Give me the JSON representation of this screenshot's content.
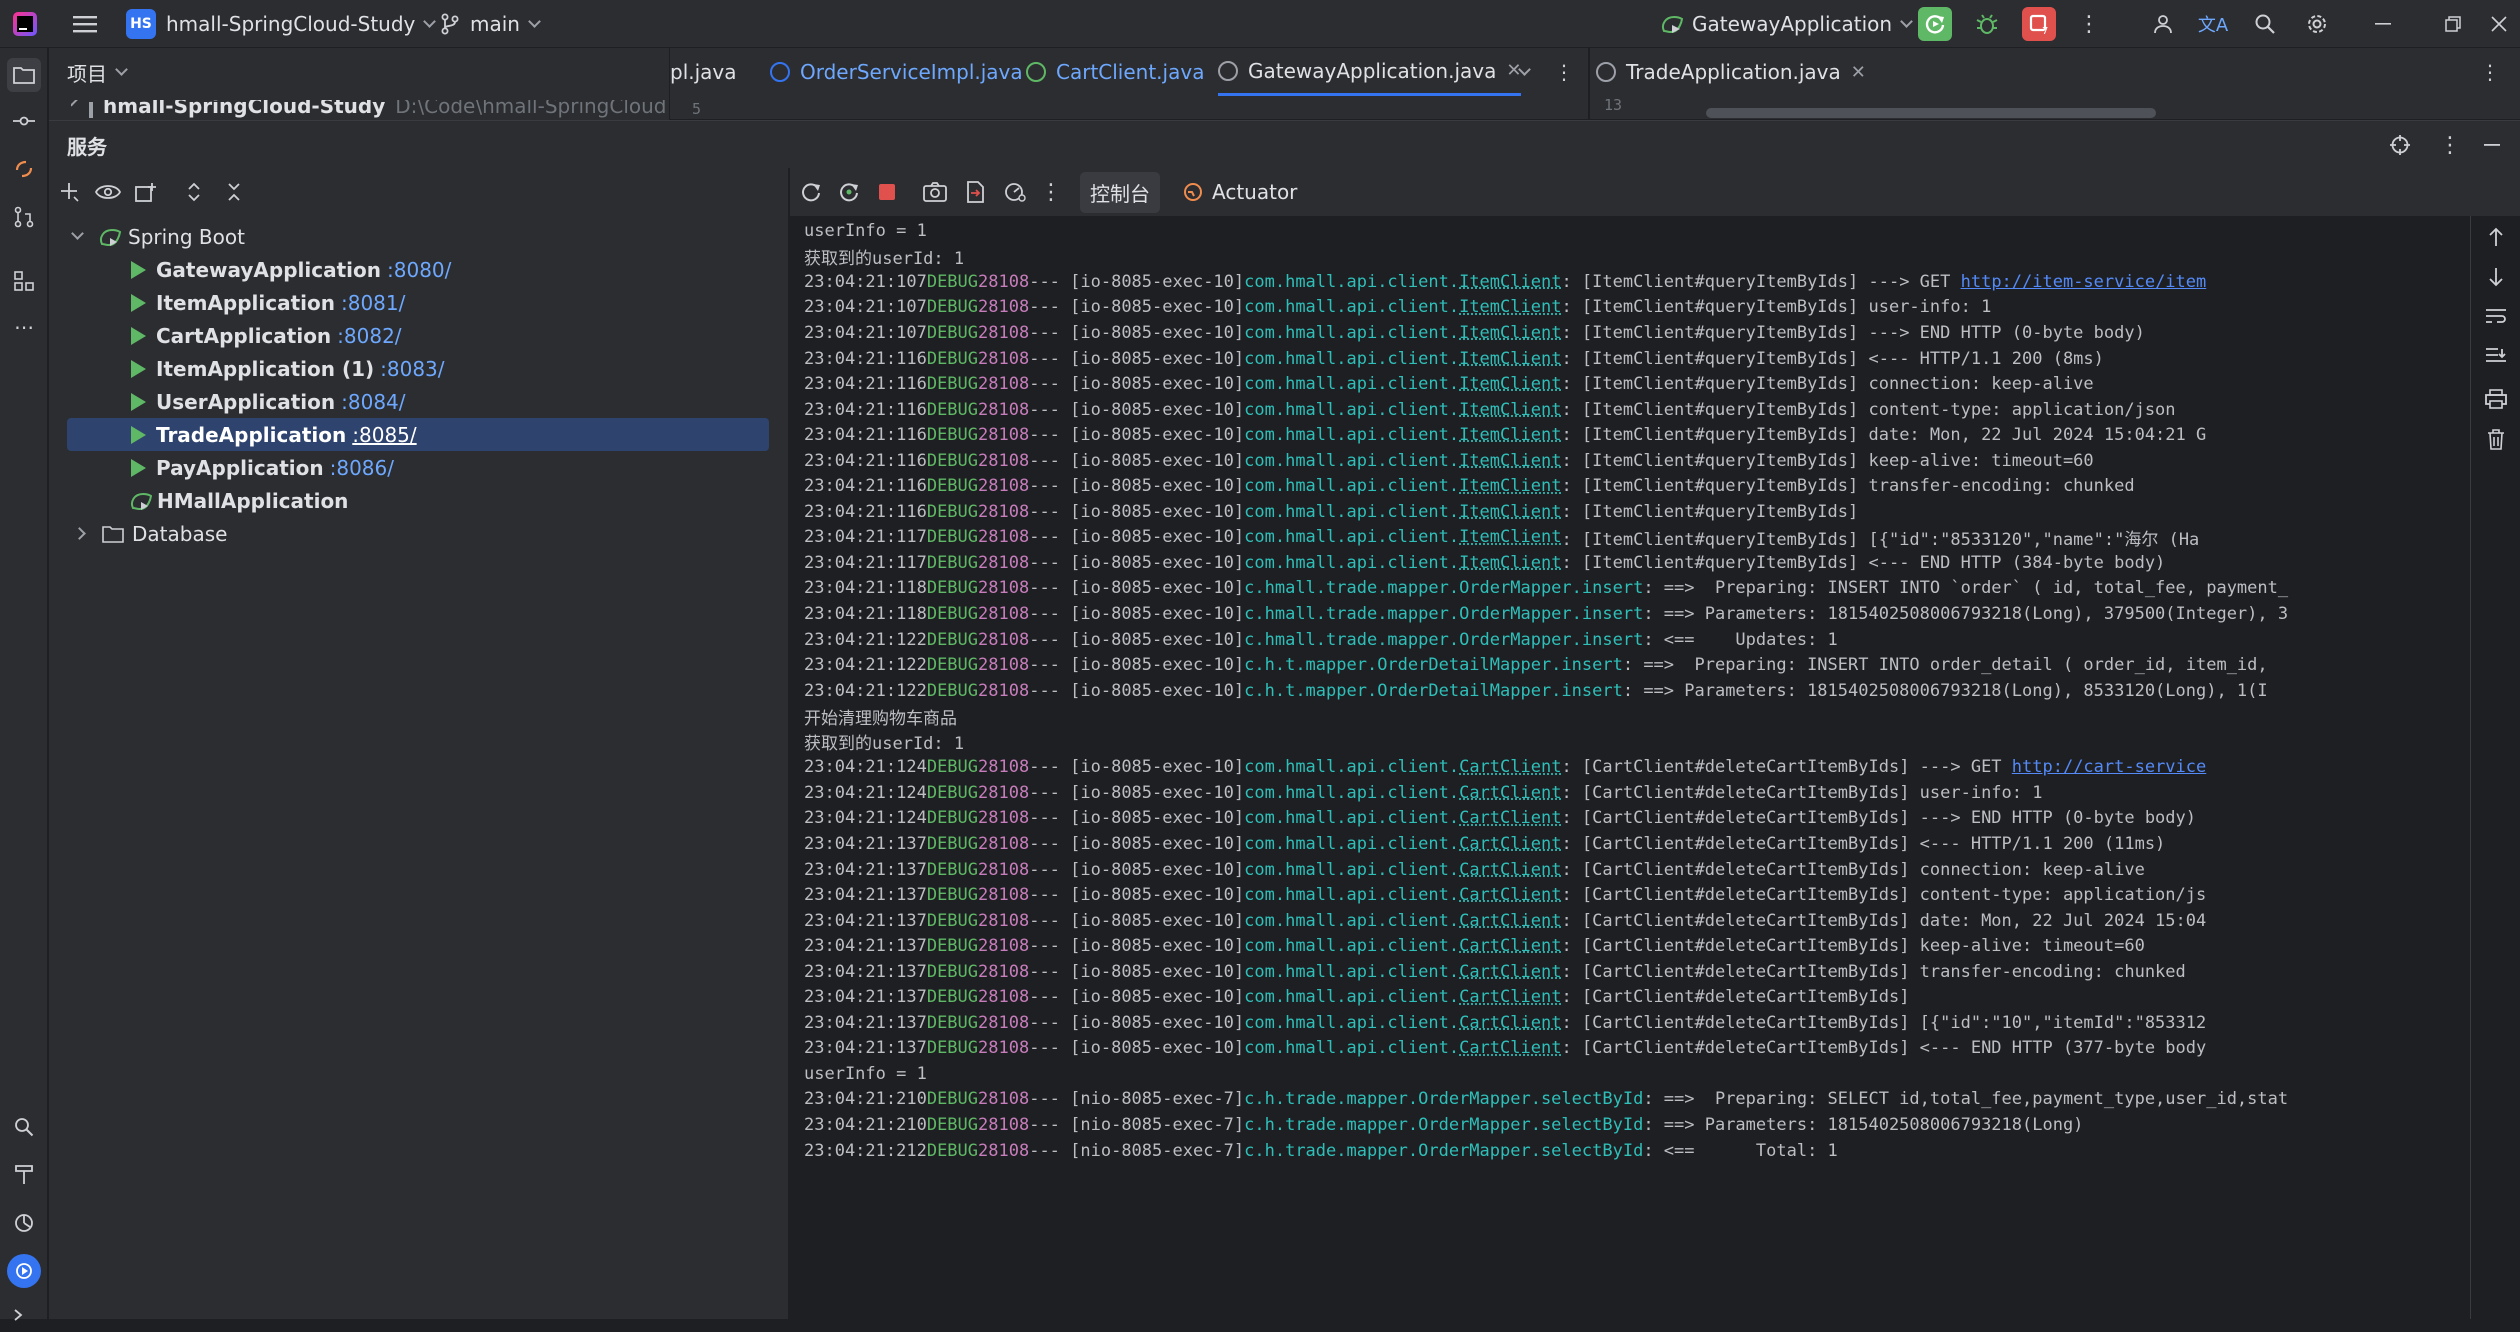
{
  "titlebar": {
    "project_badge": "HS",
    "project_name": "hmall-SpringCloud-Study",
    "branch": "main",
    "run_config": "GatewayApplication",
    "icons": [
      "app-logo-icon",
      "hamburger-menu-icon",
      "branch-icon",
      "run-config-icon",
      "rerun-icon",
      "debug-icon",
      "stop-icon",
      "more-icon",
      "user-icon",
      "translate-icon",
      "search-icon",
      "settings-icon",
      "minimize-icon",
      "restore-icon",
      "close-icon"
    ]
  },
  "project_panel": {
    "title": "项目",
    "root_label": "hmall-SpringCloud-Study",
    "root_path": "D:\\Code\\hmall-SpringCloud-St"
  },
  "editor_tabs": [
    {
      "label": "pl.java"
    },
    {
      "label": "OrderServiceImpl.java"
    },
    {
      "label": "CartClient.java"
    },
    {
      "label": "GatewayApplication.java"
    }
  ],
  "editor_tabs_right": [
    {
      "label": "TradeApplication.java"
    }
  ],
  "editor_line_left": "5",
  "editor_line_right": "13",
  "services": {
    "title": "服务",
    "console_tab": "控制台",
    "actuator_tab": "Actuator",
    "tree": {
      "group": "Spring Boot",
      "apps": [
        {
          "name": "GatewayApplication",
          "port": ":8080/"
        },
        {
          "name": "ItemApplication",
          "port": ":8081/"
        },
        {
          "name": "CartApplication",
          "port": ":8082/"
        },
        {
          "name": "ItemApplication (1)",
          "port": ":8083/"
        },
        {
          "name": "UserApplication",
          "port": ":8084/"
        },
        {
          "name": "TradeApplication",
          "port": ":8085/"
        },
        {
          "name": "PayApplication",
          "port": ":8086/"
        },
        {
          "name": "HMallApplication",
          "port": ""
        }
      ],
      "database": "Database"
    }
  },
  "console": {
    "lines": [
      {
        "plain": "userInfo = 1"
      },
      {
        "plain": "获取到的userId: 1"
      },
      {
        "t": "23:04:21:107",
        "lvl": "DEBUG",
        "pid": "28108",
        "thr": "--- [io-8085-exec-10]",
        "cls": "com.hmall.api.client.",
        "clsu": "ItemClient",
        "pad": "         ",
        "msg": ": [ItemClient#queryItemByIds] ---> GET ",
        "url": "http://item-service/item"
      },
      {
        "t": "23:04:21:107",
        "lvl": "DEBUG",
        "pid": "28108",
        "thr": "--- [io-8085-exec-10]",
        "cls": "com.hmall.api.client.",
        "clsu": "ItemClient",
        "pad": "         ",
        "msg": ": [ItemClient#queryItemByIds] user-info: 1"
      },
      {
        "t": "23:04:21:107",
        "lvl": "DEBUG",
        "pid": "28108",
        "thr": "--- [io-8085-exec-10]",
        "cls": "com.hmall.api.client.",
        "clsu": "ItemClient",
        "pad": "         ",
        "msg": ": [ItemClient#queryItemByIds] ---> END HTTP (0-byte body)"
      },
      {
        "t": "23:04:21:116",
        "lvl": "DEBUG",
        "pid": "28108",
        "thr": "--- [io-8085-exec-10]",
        "cls": "com.hmall.api.client.",
        "clsu": "ItemClient",
        "pad": "         ",
        "msg": ": [ItemClient#queryItemByIds] <--- HTTP/1.1 200 (8ms)"
      },
      {
        "t": "23:04:21:116",
        "lvl": "DEBUG",
        "pid": "28108",
        "thr": "--- [io-8085-exec-10]",
        "cls": "com.hmall.api.client.",
        "clsu": "ItemClient",
        "pad": "         ",
        "msg": ": [ItemClient#queryItemByIds] connection: keep-alive"
      },
      {
        "t": "23:04:21:116",
        "lvl": "DEBUG",
        "pid": "28108",
        "thr": "--- [io-8085-exec-10]",
        "cls": "com.hmall.api.client.",
        "clsu": "ItemClient",
        "pad": "         ",
        "msg": ": [ItemClient#queryItemByIds] content-type: application/json"
      },
      {
        "t": "23:04:21:116",
        "lvl": "DEBUG",
        "pid": "28108",
        "thr": "--- [io-8085-exec-10]",
        "cls": "com.hmall.api.client.",
        "clsu": "ItemClient",
        "pad": "         ",
        "msg": ": [ItemClient#queryItemByIds] date: Mon, 22 Jul 2024 15:04:21 G"
      },
      {
        "t": "23:04:21:116",
        "lvl": "DEBUG",
        "pid": "28108",
        "thr": "--- [io-8085-exec-10]",
        "cls": "com.hmall.api.client.",
        "clsu": "ItemClient",
        "pad": "         ",
        "msg": ": [ItemClient#queryItemByIds] keep-alive: timeout=60"
      },
      {
        "t": "23:04:21:116",
        "lvl": "DEBUG",
        "pid": "28108",
        "thr": "--- [io-8085-exec-10]",
        "cls": "com.hmall.api.client.",
        "clsu": "ItemClient",
        "pad": "         ",
        "msg": ": [ItemClient#queryItemByIds] transfer-encoding: chunked"
      },
      {
        "t": "23:04:21:116",
        "lvl": "DEBUG",
        "pid": "28108",
        "thr": "--- [io-8085-exec-10]",
        "cls": "com.hmall.api.client.",
        "clsu": "ItemClient",
        "pad": "         ",
        "msg": ": [ItemClient#queryItemByIds]"
      },
      {
        "t": "23:04:21:117",
        "lvl": "DEBUG",
        "pid": "28108",
        "thr": "--- [io-8085-exec-10]",
        "cls": "com.hmall.api.client.",
        "clsu": "ItemClient",
        "pad": "         ",
        "msg": ": [ItemClient#queryItemByIds] [{\"id\":\"8533120\",\"name\":\"海尔 (Ha"
      },
      {
        "t": "23:04:21:117",
        "lvl": "DEBUG",
        "pid": "28108",
        "thr": "--- [io-8085-exec-10]",
        "cls": "com.hmall.api.client.",
        "clsu": "ItemClient",
        "pad": "         ",
        "msg": ": [ItemClient#queryItemByIds] <--- END HTTP (384-byte body)"
      },
      {
        "t": "23:04:21:118",
        "lvl": "DEBUG",
        "pid": "28108",
        "thr": "--- [io-8085-exec-10]",
        "cls": "c.hmall.trade.mapper.OrderMapper.insert",
        "clsu": "",
        "pad": "  ",
        "msg": ": ==>  Preparing: INSERT INTO `order` ( id, total_fee, payment_"
      },
      {
        "t": "23:04:21:118",
        "lvl": "DEBUG",
        "pid": "28108",
        "thr": "--- [io-8085-exec-10]",
        "cls": "c.hmall.trade.mapper.OrderMapper.insert",
        "clsu": "",
        "pad": "  ",
        "msg": ": ==> Parameters: 1815402508006793218(Long), 379500(Integer), 3"
      },
      {
        "t": "23:04:21:122",
        "lvl": "DEBUG",
        "pid": "28108",
        "thr": "--- [io-8085-exec-10]",
        "cls": "c.hmall.trade.mapper.OrderMapper.insert",
        "clsu": "",
        "pad": "  ",
        "msg": ": <==    Updates: 1"
      },
      {
        "t": "23:04:21:122",
        "lvl": "DEBUG",
        "pid": "28108",
        "thr": "--- [io-8085-exec-10]",
        "cls": "c.h.t.mapper.OrderDetailMapper.insert",
        "clsu": "",
        "pad": "    ",
        "msg": ": ==>  Preparing: INSERT INTO order_detail ( order_id, item_id,"
      },
      {
        "t": "23:04:21:122",
        "lvl": "DEBUG",
        "pid": "28108",
        "thr": "--- [io-8085-exec-10]",
        "cls": "c.h.t.mapper.OrderDetailMapper.insert",
        "clsu": "",
        "pad": "    ",
        "msg": ": ==> Parameters: 1815402508006793218(Long), 8533120(Long), 1(I"
      },
      {
        "plain": "开始清理购物车商品"
      },
      {
        "plain": "获取到的userId: 1"
      },
      {
        "t": "23:04:21:124",
        "lvl": "DEBUG",
        "pid": "28108",
        "thr": "--- [io-8085-exec-10]",
        "cls": "com.hmall.api.client.",
        "clsu": "CartClient",
        "pad": "         ",
        "msg": ": [CartClient#deleteCartItemByIds] ---> GET ",
        "url": "http://cart-service"
      },
      {
        "t": "23:04:21:124",
        "lvl": "DEBUG",
        "pid": "28108",
        "thr": "--- [io-8085-exec-10]",
        "cls": "com.hmall.api.client.",
        "clsu": "CartClient",
        "pad": "         ",
        "msg": ": [CartClient#deleteCartItemByIds] user-info: 1"
      },
      {
        "t": "23:04:21:124",
        "lvl": "DEBUG",
        "pid": "28108",
        "thr": "--- [io-8085-exec-10]",
        "cls": "com.hmall.api.client.",
        "clsu": "CartClient",
        "pad": "         ",
        "msg": ": [CartClient#deleteCartItemByIds] ---> END HTTP (0-byte body)"
      },
      {
        "t": "23:04:21:137",
        "lvl": "DEBUG",
        "pid": "28108",
        "thr": "--- [io-8085-exec-10]",
        "cls": "com.hmall.api.client.",
        "clsu": "CartClient",
        "pad": "         ",
        "msg": ": [CartClient#deleteCartItemByIds] <--- HTTP/1.1 200 (11ms)"
      },
      {
        "t": "23:04:21:137",
        "lvl": "DEBUG",
        "pid": "28108",
        "thr": "--- [io-8085-exec-10]",
        "cls": "com.hmall.api.client.",
        "clsu": "CartClient",
        "pad": "         ",
        "msg": ": [CartClient#deleteCartItemByIds] connection: keep-alive"
      },
      {
        "t": "23:04:21:137",
        "lvl": "DEBUG",
        "pid": "28108",
        "thr": "--- [io-8085-exec-10]",
        "cls": "com.hmall.api.client.",
        "clsu": "CartClient",
        "pad": "         ",
        "msg": ": [CartClient#deleteCartItemByIds] content-type: application/js"
      },
      {
        "t": "23:04:21:137",
        "lvl": "DEBUG",
        "pid": "28108",
        "thr": "--- [io-8085-exec-10]",
        "cls": "com.hmall.api.client.",
        "clsu": "CartClient",
        "pad": "         ",
        "msg": ": [CartClient#deleteCartItemByIds] date: Mon, 22 Jul 2024 15:04"
      },
      {
        "t": "23:04:21:137",
        "lvl": "DEBUG",
        "pid": "28108",
        "thr": "--- [io-8085-exec-10]",
        "cls": "com.hmall.api.client.",
        "clsu": "CartClient",
        "pad": "         ",
        "msg": ": [CartClient#deleteCartItemByIds] keep-alive: timeout=60"
      },
      {
        "t": "23:04:21:137",
        "lvl": "DEBUG",
        "pid": "28108",
        "thr": "--- [io-8085-exec-10]",
        "cls": "com.hmall.api.client.",
        "clsu": "CartClient",
        "pad": "         ",
        "msg": ": [CartClient#deleteCartItemByIds] transfer-encoding: chunked"
      },
      {
        "t": "23:04:21:137",
        "lvl": "DEBUG",
        "pid": "28108",
        "thr": "--- [io-8085-exec-10]",
        "cls": "com.hmall.api.client.",
        "clsu": "CartClient",
        "pad": "         ",
        "msg": ": [CartClient#deleteCartItemByIds]"
      },
      {
        "t": "23:04:21:137",
        "lvl": "DEBUG",
        "pid": "28108",
        "thr": "--- [io-8085-exec-10]",
        "cls": "com.hmall.api.client.",
        "clsu": "CartClient",
        "pad": "         ",
        "msg": ": [CartClient#deleteCartItemByIds] [{\"id\":\"10\",\"itemId\":\"853312"
      },
      {
        "t": "23:04:21:137",
        "lvl": "DEBUG",
        "pid": "28108",
        "thr": "--- [io-8085-exec-10]",
        "cls": "com.hmall.api.client.",
        "clsu": "CartClient",
        "pad": "         ",
        "msg": ": [CartClient#deleteCartItemByIds] <--- END HTTP (377-byte body"
      },
      {
        "plain": "userInfo = 1"
      },
      {
        "t": "23:04:21:210",
        "lvl": "DEBUG",
        "pid": "28108",
        "thr": "--- [nio-8085-exec-7]",
        "cls": "c.h.trade.mapper.OrderMapper.selectById",
        "clsu": "",
        "pad": "  ",
        "msg": ": ==>  Preparing: SELECT id,total_fee,payment_type,user_id,stat"
      },
      {
        "t": "23:04:21:210",
        "lvl": "DEBUG",
        "pid": "28108",
        "thr": "--- [nio-8085-exec-7]",
        "cls": "c.h.trade.mapper.OrderMapper.selectById",
        "clsu": "",
        "pad": "  ",
        "msg": ": ==> Parameters: 1815402508006793218(Long)"
      },
      {
        "t": "23:04:21:212",
        "lvl": "DEBUG",
        "pid": "28108",
        "thr": "--- [nio-8085-exec-7]",
        "cls": "c.h.trade.mapper.OrderMapper.selectById",
        "clsu": "",
        "pad": "  ",
        "msg": ": <==      Total: 1"
      }
    ]
  },
  "colors": {
    "accent": "#3574f0",
    "debug": "#5fb865",
    "pid": "#c77dbb",
    "logger": "#2fbfb9",
    "link": "#548af7",
    "selection": "#2e436e",
    "stop": "#e0514d"
  }
}
